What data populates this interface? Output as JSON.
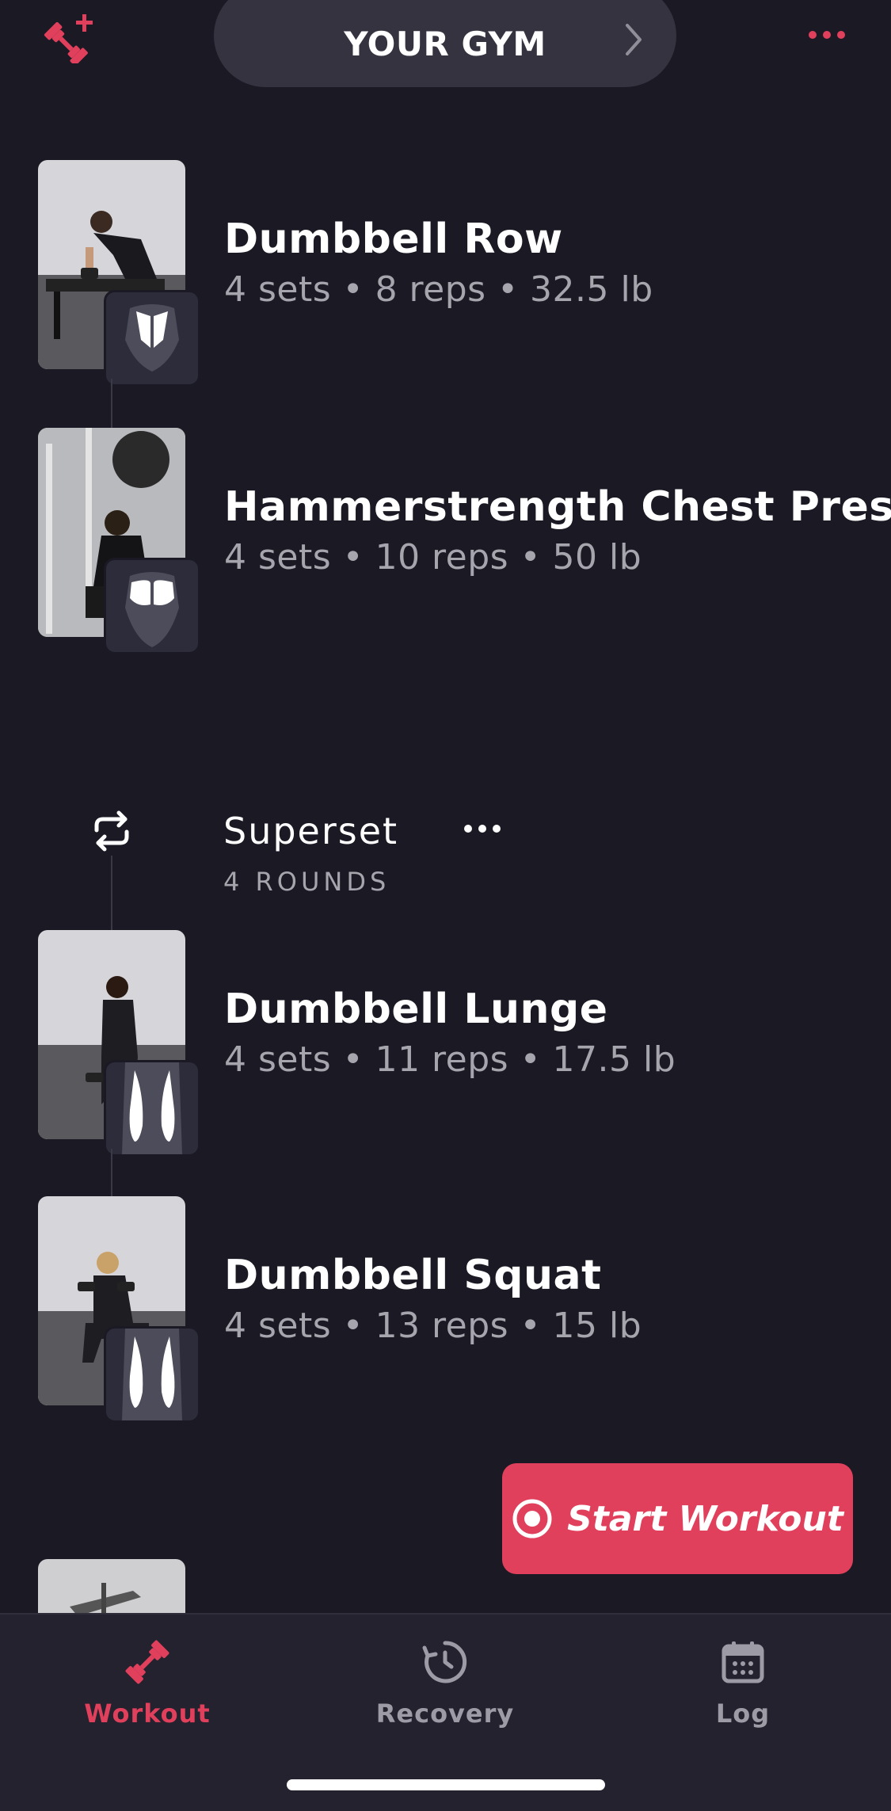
{
  "header": {
    "gym_title": "YOUR GYM"
  },
  "icons": {
    "add_exercise": "dumbbell-plus-icon",
    "more": "more-horizontal-icon",
    "chevron": "chevron-right-icon",
    "superset": "repeat-icon"
  },
  "exercises_top": [
    {
      "name": "Dumbbell Row",
      "detail": "4 sets • 8 reps • 32.5 lb"
    },
    {
      "name": "Hammerstrength Chest Press",
      "detail": "4 sets • 10 reps • 50 lb"
    }
  ],
  "superset": {
    "title": "Superset",
    "rounds": "4 ROUNDS",
    "exercises": [
      {
        "name": "Dumbbell Lunge",
        "detail": "4 sets • 11 reps • 17.5 lb"
      },
      {
        "name": "Dumbbell Squat",
        "detail": "4 sets • 13 reps • 15 lb"
      }
    ]
  },
  "start_button": {
    "label": "Start Workout"
  },
  "tabbar": {
    "tabs": [
      {
        "label": "Workout",
        "icon": "dumbbell-icon",
        "active": true
      },
      {
        "label": "Recovery",
        "icon": "recovery-clock-icon",
        "active": false
      },
      {
        "label": "Log",
        "icon": "calendar-icon",
        "active": false
      }
    ]
  },
  "colors": {
    "background": "#1b1a24",
    "accent": "#e0405b",
    "secondary_text": "#a6a5ae",
    "pill": "#34333f",
    "tabbar": "#23222e"
  }
}
